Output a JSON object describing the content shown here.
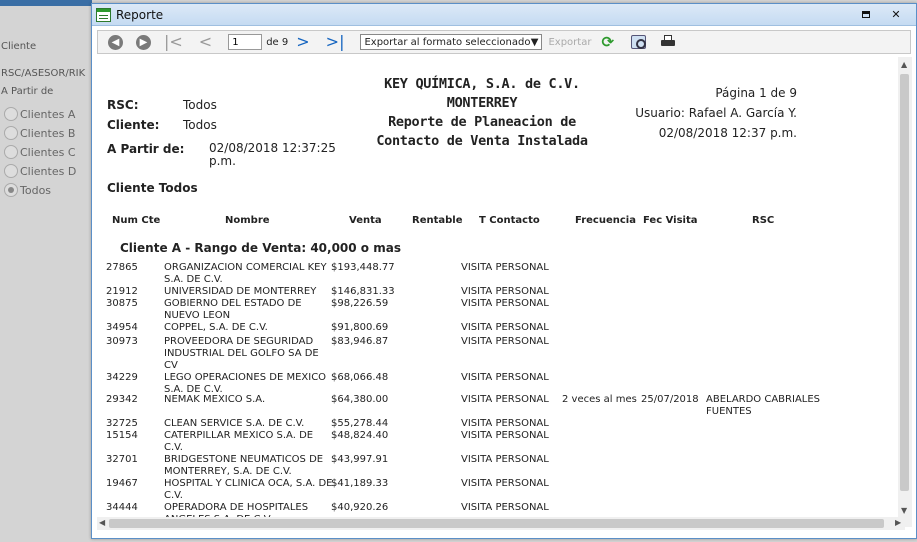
{
  "left_panel": {
    "cliente_label": "Cliente",
    "rsc_label": "RSC/ASESOR/RIK",
    "apartir_label": "A Partir de",
    "radios": [
      {
        "label": "Clientes A",
        "checked": false
      },
      {
        "label": "Clientes B",
        "checked": false
      },
      {
        "label": "Clientes C",
        "checked": false
      },
      {
        "label": "Clientes D",
        "checked": false
      },
      {
        "label": "Todos",
        "checked": true
      }
    ]
  },
  "dialog": {
    "title": "Reporte",
    "toolbar": {
      "page_value": "1",
      "of_label": "de 9",
      "export_select": "Exportar al formato seleccionado",
      "export_link": "Exportar"
    }
  },
  "report": {
    "company": "KEY QUÍMICA, S.A. de C.V.",
    "city": "MONTERREY",
    "title_line1": "Reporte de Planeacion de",
    "title_line2": "Contacto de Venta Instalada",
    "page_info": "Página 1 de 9",
    "user_info": "Usuario: Rafael A. García Y.",
    "datetime": "02/08/2018  12:37 p.m.",
    "rsc_label": "RSC:",
    "rsc_value": "Todos",
    "cliente_label": "Cliente:",
    "cliente_value": "Todos",
    "apartir_label": "A Partir de:",
    "apartir_value_l1": "02/08/2018 12:37:25",
    "apartir_value_l2": "p.m.",
    "cliente_todos": "Cliente Todos",
    "headers": {
      "num": "Num Cte",
      "nombre": "Nombre",
      "venta": "Venta",
      "rentable": "Rentable",
      "tcontacto": "T Contacto",
      "frecuencia": "Frecuencia",
      "fecvisita": "Fec Visita",
      "rsc": "RSC"
    },
    "group_title": "Cliente A  - Rango de Venta: 40,000 o mas",
    "rows": [
      {
        "num": "27865",
        "nombre": "ORGANIZACION COMERCIAL KEY S.A. DE C.V.",
        "venta": "$193,448.77",
        "tcontacto": "VISITA PERSONAL",
        "frecuencia": "",
        "fec": "",
        "rsc": ""
      },
      {
        "num": "21912",
        "nombre": "UNIVERSIDAD DE MONTERREY",
        "venta": "$146,831.33",
        "tcontacto": "VISITA PERSONAL",
        "frecuencia": "",
        "fec": "",
        "rsc": ""
      },
      {
        "num": "30875",
        "nombre": "GOBIERNO DEL ESTADO DE NUEVO LEON",
        "venta": "$98,226.59",
        "tcontacto": "VISITA PERSONAL",
        "frecuencia": "",
        "fec": "",
        "rsc": ""
      },
      {
        "num": "34954",
        "nombre": "COPPEL, S.A. DE C.V.",
        "venta": "$91,800.69",
        "tcontacto": "VISITA PERSONAL",
        "frecuencia": "",
        "fec": "",
        "rsc": ""
      },
      {
        "num": "30973",
        "nombre": "PROVEEDORA DE SEGURIDAD INDUSTRIAL DEL GOLFO SA DE CV",
        "venta": "$83,946.87",
        "tcontacto": "VISITA PERSONAL",
        "frecuencia": "",
        "fec": "",
        "rsc": ""
      },
      {
        "num": "34229",
        "nombre": "LEGO OPERACIONES DE MEXICO S.A. DE C.V.",
        "venta": "$68,066.48",
        "tcontacto": "VISITA PERSONAL",
        "frecuencia": "",
        "fec": "",
        "rsc": ""
      },
      {
        "num": "29342",
        "nombre": "NEMAK MEXICO S.A.",
        "venta": "$64,380.00",
        "tcontacto": "VISITA PERSONAL",
        "frecuencia": "2 veces al mes",
        "fec": "25/07/2018",
        "rsc": "ABELARDO CABRIALES FUENTES"
      },
      {
        "num": "32725",
        "nombre": "CLEAN SERVICE S.A. DE C.V.",
        "venta": "$55,278.44",
        "tcontacto": "VISITA PERSONAL",
        "frecuencia": "",
        "fec": "",
        "rsc": ""
      },
      {
        "num": "15154",
        "nombre": "CATERPILLAR MEXICO S.A. DE C.V.",
        "venta": "$48,824.40",
        "tcontacto": "VISITA PERSONAL",
        "frecuencia": "",
        "fec": "",
        "rsc": ""
      },
      {
        "num": "32701",
        "nombre": "BRIDGESTONE NEUMATICOS DE MONTERREY, S.A. DE C.V.",
        "venta": "$43,997.91",
        "tcontacto": "VISITA PERSONAL",
        "frecuencia": "",
        "fec": "",
        "rsc": ""
      },
      {
        "num": "19467",
        "nombre": "HOSPITAL Y CLINICA OCA, S.A. DE C.V.",
        "venta": "$41,189.33",
        "tcontacto": "VISITA PERSONAL",
        "frecuencia": "",
        "fec": "",
        "rsc": ""
      },
      {
        "num": "34444",
        "nombre": "OPERADORA DE HOSPITALES ANGELES S.A. DE C.V.",
        "venta": "$40,920.26",
        "tcontacto": "VISITA PERSONAL",
        "frecuencia": "",
        "fec": "",
        "rsc": ""
      }
    ]
  }
}
